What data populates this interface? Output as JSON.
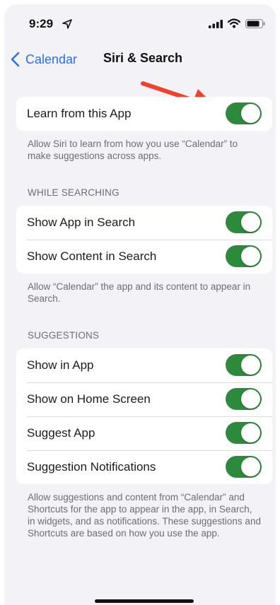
{
  "status_bar": {
    "time": "9:29",
    "location_icon": "location-arrow-icon",
    "signal_icon": "cellular-signal-icon",
    "wifi_icon": "wifi-icon",
    "battery_icon": "battery-icon"
  },
  "nav": {
    "back_label": "Calendar",
    "title": "Siri & Search"
  },
  "colors": {
    "accent_blue": "#2f6fdf",
    "toggle_on": "#2d8a3c",
    "annotation_arrow": "#f0412a"
  },
  "learn_group": {
    "rows": [
      {
        "label": "Learn from this App",
        "on": true
      }
    ],
    "footer": "Allow Siri to learn from how you use “Calendar” to make suggestions across apps."
  },
  "while_searching": {
    "header": "WHILE SEARCHING",
    "rows": [
      {
        "label": "Show App in Search",
        "on": true
      },
      {
        "label": "Show Content in Search",
        "on": true
      }
    ],
    "footer": "Allow “Calendar” the app and its content to appear in Search."
  },
  "suggestions": {
    "header": "SUGGESTIONS",
    "rows": [
      {
        "label": "Show in App",
        "on": true
      },
      {
        "label": "Show on Home Screen",
        "on": true
      },
      {
        "label": "Suggest App",
        "on": true
      },
      {
        "label": "Suggestion Notifications",
        "on": true
      }
    ],
    "footer": "Allow suggestions and content from “Calendar” and Shortcuts for the app to appear in the app, in Search, in widgets, and as notifications. These suggestions and Shortcuts are based on how you use the app."
  }
}
